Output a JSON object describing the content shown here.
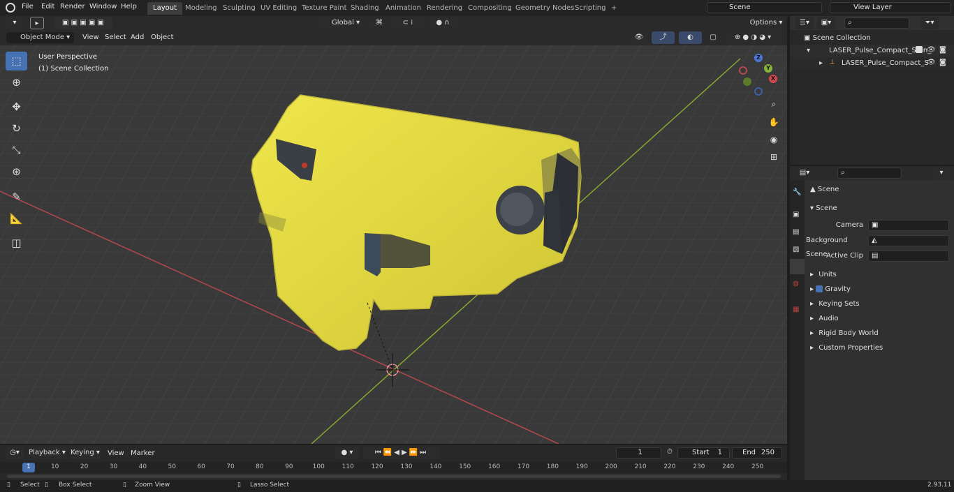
{
  "menus": [
    "File",
    "Edit",
    "Render",
    "Window",
    "Help"
  ],
  "workspaces": [
    "Layout",
    "Modeling",
    "Sculpting",
    "UV Editing",
    "Texture Paint",
    "Shading",
    "Animation",
    "Rendering",
    "Compositing",
    "Geometry Nodes",
    "Scripting"
  ],
  "workspace_add": "+",
  "scene_name": "Scene",
  "view_layer": "View Layer",
  "toolbar": {
    "mode": "Object Mode",
    "view": "View",
    "select": "Select",
    "add": "Add",
    "object": "Object",
    "orientation": "Global",
    "options": "Options"
  },
  "viewport": {
    "perspective": "User Perspective",
    "collection": "(1) Scene Collection"
  },
  "gizmo": {
    "x": "X",
    "y": "Y",
    "z": "Z"
  },
  "outliner": {
    "root": "Scene Collection",
    "collection": "LASER_Pulse_Compact_Stun_",
    "object": "LASER_Pulse_Compact_S"
  },
  "properties": {
    "header": "Scene",
    "panel": "Scene",
    "camera_label": "Camera",
    "background_label": "Background Scene",
    "clip_label": "Active Clip",
    "sections": [
      "Units",
      "Gravity",
      "Keying Sets",
      "Audio",
      "Rigid Body World",
      "Custom Properties"
    ],
    "gravity_checked": true
  },
  "timeline": {
    "menus": [
      "Playback",
      "Keying",
      "View",
      "Marker"
    ],
    "current_frame": "1",
    "start_label": "Start",
    "start": "1",
    "end_label": "End",
    "end": "250",
    "ticks": [
      "1",
      "10",
      "20",
      "30",
      "40",
      "50",
      "60",
      "70",
      "80",
      "90",
      "100",
      "110",
      "120",
      "130",
      "140",
      "150",
      "160",
      "170",
      "180",
      "190",
      "200",
      "210",
      "220",
      "230",
      "240",
      "250"
    ]
  },
  "status": {
    "select": "Select",
    "box_select": "Box Select",
    "zoom_view": "Zoom View",
    "lasso": "Lasso Select",
    "version": "2.93.11"
  },
  "colors": {
    "accent": "#4772b3",
    "object_yellow": "#e3dc3a",
    "x_axis": "#b5474f",
    "y_axis": "#86a82f"
  }
}
